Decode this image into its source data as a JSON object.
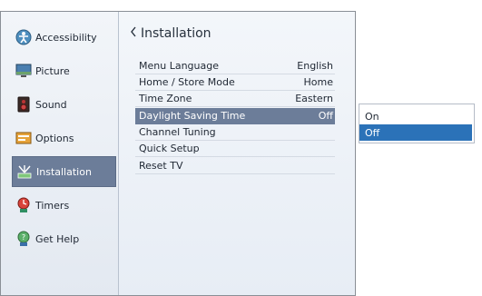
{
  "sidebar": {
    "items": [
      {
        "label": "Accessibility",
        "icon": "accessibility-icon"
      },
      {
        "label": "Picture",
        "icon": "picture-icon"
      },
      {
        "label": "Sound",
        "icon": "speaker-icon"
      },
      {
        "label": "Options",
        "icon": "options-icon"
      },
      {
        "label": "Installation",
        "icon": "installation-icon",
        "active": true
      },
      {
        "label": "Timers",
        "icon": "timer-icon"
      },
      {
        "label": "Get Help",
        "icon": "help-icon"
      }
    ]
  },
  "main": {
    "title": "Installation",
    "rows": [
      {
        "label": "Menu Language",
        "value": "English"
      },
      {
        "label": "Home / Store Mode",
        "value": "Home"
      },
      {
        "label": "Time Zone",
        "value": "Eastern"
      },
      {
        "label": "Daylight Saving Time",
        "value": "Off",
        "active": true
      },
      {
        "label": "Channel Tuning",
        "value": ""
      },
      {
        "label": "Quick Setup",
        "value": ""
      },
      {
        "label": "Reset TV",
        "value": ""
      }
    ]
  },
  "popup": {
    "options": [
      {
        "label": "On"
      },
      {
        "label": "Off",
        "active": true
      }
    ]
  },
  "colors": {
    "highlight": "#6c7d99",
    "popup_selected": "#2b72b8"
  }
}
